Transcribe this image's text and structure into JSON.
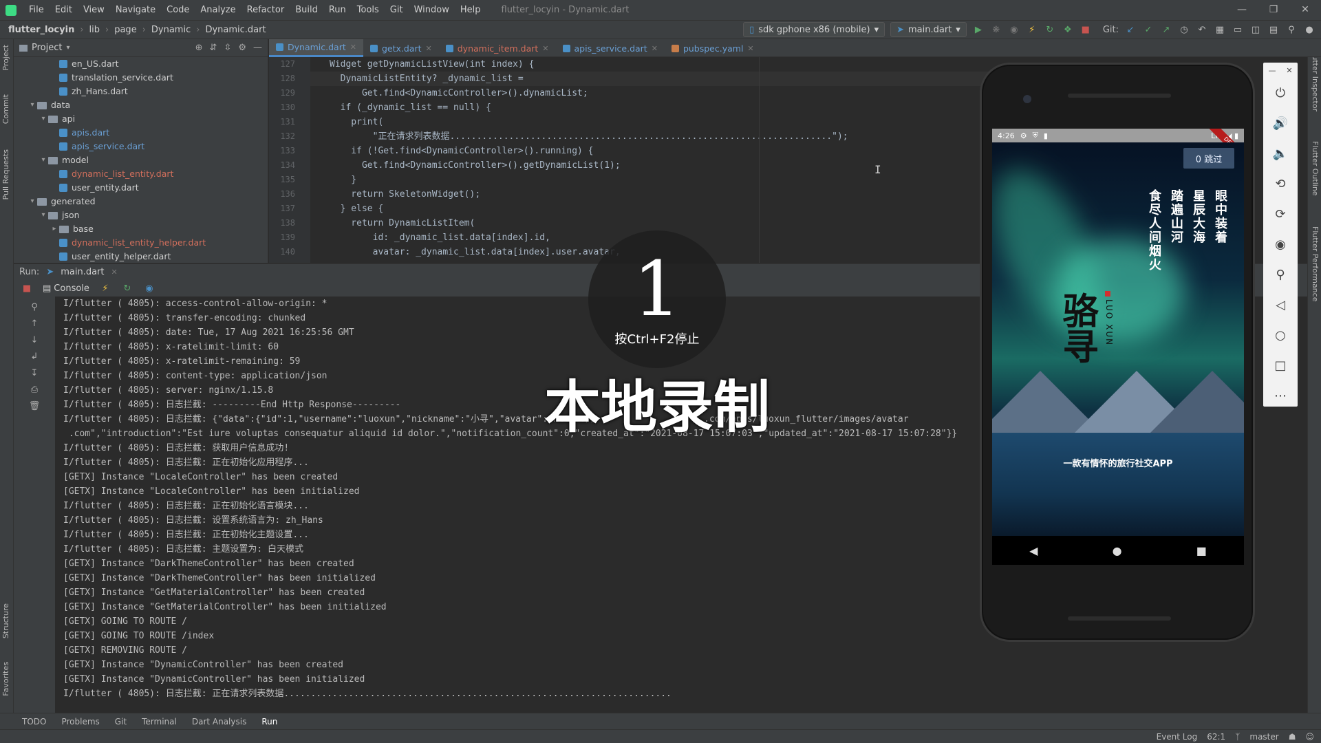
{
  "menu": {
    "items": [
      "File",
      "Edit",
      "View",
      "Navigate",
      "Code",
      "Analyze",
      "Refactor",
      "Build",
      "Run",
      "Tools",
      "Git",
      "Window",
      "Help"
    ],
    "window_title": "flutter_locyin - Dynamic.dart"
  },
  "nav": {
    "breadcrumbs": [
      "flutter_locyin",
      "lib",
      "page",
      "Dynamic",
      "Dynamic.dart"
    ],
    "device": "sdk gphone x86 (mobile)",
    "run_config": "main.dart",
    "git_label": "Git:"
  },
  "side_tabs": {
    "left": [
      "Project",
      "Commit",
      "Pull Requests",
      "Structure",
      "Favorites"
    ],
    "right": [
      "Flutter Inspector",
      "Flutter Outline",
      "Flutter Performance"
    ]
  },
  "project": {
    "title": "Project",
    "tree": [
      {
        "indent": 3,
        "type": "file",
        "label": "en_US.dart",
        "style": ""
      },
      {
        "indent": 3,
        "type": "file",
        "label": "translation_service.dart",
        "style": ""
      },
      {
        "indent": 3,
        "type": "file",
        "label": "zh_Hans.dart",
        "style": ""
      },
      {
        "indent": 1,
        "type": "folder",
        "label": "data",
        "style": "",
        "open": true
      },
      {
        "indent": 2,
        "type": "folder",
        "label": "api",
        "style": "",
        "open": true
      },
      {
        "indent": 3,
        "type": "file",
        "label": "apis.dart",
        "style": "mod"
      },
      {
        "indent": 3,
        "type": "file",
        "label": "apis_service.dart",
        "style": "mod"
      },
      {
        "indent": 2,
        "type": "folder",
        "label": "model",
        "style": "",
        "open": true
      },
      {
        "indent": 3,
        "type": "file",
        "label": "dynamic_list_entity.dart",
        "style": "err"
      },
      {
        "indent": 3,
        "type": "file",
        "label": "user_entity.dart",
        "style": ""
      },
      {
        "indent": 1,
        "type": "folder",
        "label": "generated",
        "style": "",
        "open": true
      },
      {
        "indent": 2,
        "type": "folder",
        "label": "json",
        "style": "",
        "open": true
      },
      {
        "indent": 3,
        "type": "folder",
        "label": "base",
        "style": "",
        "open": false
      },
      {
        "indent": 3,
        "type": "file",
        "label": "dynamic_list_entity_helper.dart",
        "style": "err"
      },
      {
        "indent": 3,
        "type": "file",
        "label": "user_entity_helper.dart",
        "style": ""
      }
    ]
  },
  "editor": {
    "tabs": [
      {
        "label": "Dynamic.dart",
        "active": true,
        "style": "",
        "icon": "dart"
      },
      {
        "label": "getx.dart",
        "active": false,
        "style": "",
        "icon": "dart"
      },
      {
        "label": "dynamic_item.dart",
        "active": false,
        "style": "err",
        "icon": "dart"
      },
      {
        "label": "apis_service.dart",
        "active": false,
        "style": "",
        "icon": "dart"
      },
      {
        "label": "pubspec.yaml",
        "active": false,
        "style": "",
        "icon": "yaml"
      }
    ],
    "line_numbers": [
      "127",
      "128",
      "129",
      "130",
      "131",
      "132",
      "133",
      "134",
      "135",
      "136",
      "137",
      "138",
      "139",
      "140"
    ],
    "lines": [
      "Widget getDynamicListView(int index) {",
      "  DynamicListEntity? _dynamic_list =",
      "      Get.find<DynamicController>().dynamicList;",
      "  if (_dynamic_list == null) {",
      "    print(",
      "        \"正在请求列表数据.......................................................................\");",
      "    if (!Get.find<DynamicController>().running) {",
      "      Get.find<DynamicController>().getDynamicList(1);",
      "    }",
      "    return SkeletonWidget();",
      "  } else {",
      "    return DynamicListItem(",
      "        id: _dynamic_list.data[index].id,",
      "        avatar: _dynamic_list.data[index].user.avatar,"
    ]
  },
  "run": {
    "label": "Run:",
    "tab": "main.dart",
    "console_tab": "Console",
    "log": [
      "I/flutter ( 4805): access-control-allow-origin: *",
      "I/flutter ( 4805): transfer-encoding: chunked",
      "I/flutter ( 4805): date: Tue, 17 Aug 2021 16:25:56 GMT",
      "I/flutter ( 4805): x-ratelimit-limit: 60",
      "I/flutter ( 4805): x-ratelimit-remaining: 59",
      "I/flutter ( 4805): content-type: application/json",
      "I/flutter ( 4805): server: nginx/1.15.8",
      "I/flutter ( 4805): 日志拦截: ---------End Http Response---------",
      "I/flutter ( 4805): 日志拦截: {\"data\":{\"id\":1,\"username\":\"luoxun\",\"nickname\":\"小寻\",\"avatar\":\"https://                    .com/apps/luoxun_flutter/images/avatar",
      " .com\",\"introduction\":\"Est iure voluptas consequatur aliquid id dolor.\",\"notification_count\":0,\"created_at\":\"2021-08-17 15:07:03\",\"updated_at\":\"2021-08-17 15:07:28\"}}",
      "I/flutter ( 4805): 日志拦截: 获取用户信息成功!",
      "I/flutter ( 4805): 日志拦截: 正在初始化应用程序...",
      "[GETX] Instance \"LocaleController\" has been created",
      "[GETX] Instance \"LocaleController\" has been initialized",
      "I/flutter ( 4805): 日志拦截: 正在初始化语言模块...",
      "I/flutter ( 4805): 日志拦截: 设置系统语言为: zh_Hans",
      "I/flutter ( 4805): 日志拦截: 正在初始化主题设置...",
      "I/flutter ( 4805): 日志拦截: 主题设置为: 白天模式",
      "[GETX] Instance \"DarkThemeController\" has been created",
      "[GETX] Instance \"DarkThemeController\" has been initialized",
      "[GETX] Instance \"GetMaterialController\" has been created",
      "[GETX] Instance \"GetMaterialController\" has been initialized",
      "[GETX] GOING TO ROUTE /",
      "[GETX] GOING TO ROUTE /index",
      "[GETX] REMOVING ROUTE /",
      "[GETX] Instance \"DynamicController\" has been created",
      "[GETX] Instance \"DynamicController\" has been initialized",
      "I/flutter ( 4805): 日志拦截: 正在请求列表数据........................................................................"
    ]
  },
  "bottom_tools": [
    "TODO",
    "Problems",
    "Git",
    "Terminal",
    "Dart Analysis",
    "Run"
  ],
  "status": {
    "event_log": "Event Log",
    "position": "62:1",
    "branch": "master"
  },
  "overlay": {
    "countdown": "1",
    "hint": "按Ctrl+F2停止",
    "label": "本地录制"
  },
  "phone": {
    "time": "4:26",
    "network": "LTE",
    "debug": "DEBUG",
    "skip": "0 跳过",
    "poem_cols": [
      "眼中装着",
      "星辰大海",
      "踏遍山河",
      "食尽人间烟火"
    ],
    "brand": "骆寻",
    "brand_sub": "LUO XUN",
    "slogan": "一款有情怀的旅行社交APP"
  },
  "colors": {
    "accent": "#4a88c7",
    "background": "#2b2b2b",
    "panel": "#3c3f41"
  }
}
